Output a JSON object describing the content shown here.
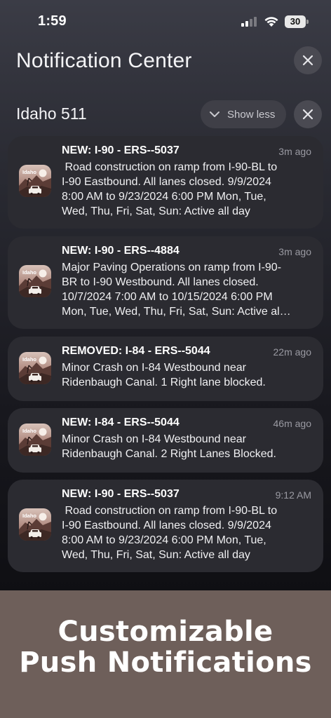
{
  "status_bar": {
    "time": "1:59",
    "battery": "30"
  },
  "notification_center": {
    "title": "Notification Center"
  },
  "group": {
    "app_name": "Idaho 511",
    "show_less_label": "Show less"
  },
  "notifications": [
    {
      "title": "NEW: I-90 - ERS--5037",
      "time": "3m ago",
      "lines": [
        " Road construction on ramp from I-90-BL to",
        "I-90 Eastbound. All lanes closed. 9/9/2024",
        "8:00 AM to 9/23/2024 6:00 PM Mon, Tue,",
        "Wed, Thu, Fri, Sat, Sun: Active all day"
      ]
    },
    {
      "title": "NEW: I-90 - ERS--4884",
      "time": "3m ago",
      "lines": [
        "Major Paving Operations on ramp from I-90-",
        "BR to I-90 Westbound. All lanes closed.",
        "10/7/2024 7:00 AM to 10/15/2024 6:00 PM",
        "Mon, Tue, Wed, Thu, Fri, Sat, Sun: Active al…"
      ]
    },
    {
      "title": "REMOVED: I-84 - ERS--5044",
      "time": "22m ago",
      "lines": [
        "Minor Crash on I-84 Westbound near",
        "Ridenbaugh Canal. 1 Right lane blocked."
      ]
    },
    {
      "title": "NEW: I-84 - ERS--5044",
      "time": "46m ago",
      "lines": [
        "Minor Crash on I-84 Westbound near",
        "Ridenbaugh Canal. 2 Right Lanes Blocked."
      ]
    },
    {
      "title": "NEW: I-90 - ERS--5037",
      "time": "9:12 AM",
      "lines": [
        " Road construction on ramp from I-90-BL to",
        "I-90 Eastbound. All lanes closed. 9/9/2024",
        "8:00 AM to 9/23/2024 6:00 PM Mon, Tue,",
        "Wed, Thu, Fri, Sat, Sun: Active all day"
      ]
    }
  ],
  "app_icon": {
    "name": "idaho-511-app-icon",
    "label": "Idaho"
  },
  "promo": {
    "line1": "Customizable",
    "line2": "Push Notifications"
  },
  "colors": {
    "promo_background": "#6e5f5a",
    "card_background": "#2b2b31",
    "button_background": "#4a4a52"
  }
}
